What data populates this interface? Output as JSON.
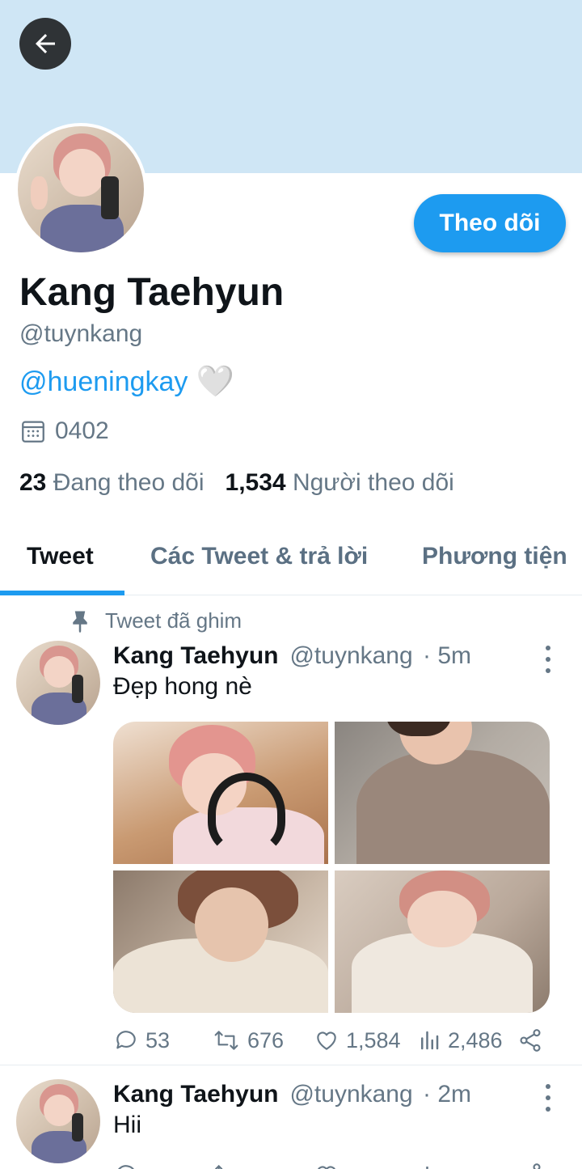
{
  "profile": {
    "display_name": "Kang Taehyun",
    "handle": "@tuynkang",
    "bio_mention": "@hueningkay",
    "bio_emoji": "🤍",
    "birthday": "0402",
    "following_count": "23",
    "following_label": "Đang theo dõi",
    "followers_count": "1,534",
    "followers_label": "Người theo dõi",
    "follow_button": "Theo dõi"
  },
  "tabs": [
    {
      "label": "Tweet",
      "active": true
    },
    {
      "label": "Các Tweet & trả lời",
      "active": false
    },
    {
      "label": "Phương tiện",
      "active": false
    }
  ],
  "pinned_label": "Tweet đã ghim",
  "tweets": [
    {
      "name": "Kang Taehyun",
      "handle": "@tuynkang",
      "time": "· 5m",
      "text": "Đẹp hong nè",
      "replies": "53",
      "retweets": "676",
      "likes": "1,584",
      "views": "2,486"
    },
    {
      "name": "Kang Taehyun",
      "handle": "@tuynkang",
      "time": "· 2m",
      "text": "Hii"
    }
  ],
  "colors": {
    "accent": "#1d9bf0",
    "banner": "#cfe6f5",
    "secondary_text": "#657786"
  },
  "icons": [
    "arrow-left-icon",
    "calendar-icon",
    "pin-icon",
    "more-vertical-icon",
    "reply-icon",
    "retweet-icon",
    "like-icon",
    "views-icon",
    "share-icon"
  ]
}
